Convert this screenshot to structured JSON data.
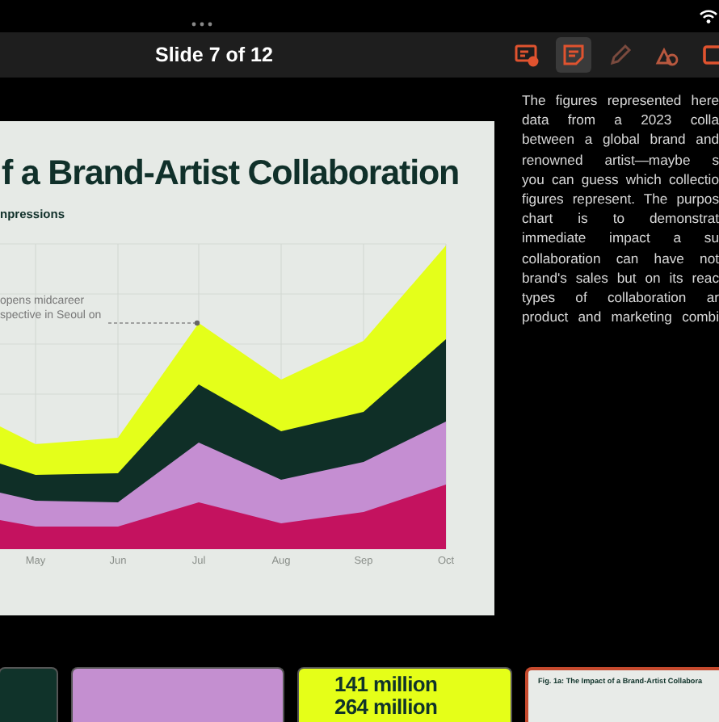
{
  "toolbar": {
    "title": "Slide 7 of 12",
    "tools": [
      {
        "kind": "presenter",
        "selected": false
      },
      {
        "kind": "notes",
        "selected": true
      },
      {
        "kind": "pen",
        "selected": false
      },
      {
        "kind": "shapes",
        "selected": false
      },
      {
        "kind": "display",
        "selected": false
      }
    ]
  },
  "slide": {
    "title": "f a Brand-Artist Collaboration",
    "subtitle": "npressions",
    "annotation": [
      "opens midcareer",
      "spective in Seoul on"
    ],
    "months": [
      "May",
      "Jun",
      "Jul",
      "Aug",
      "Sep",
      "Oct"
    ]
  },
  "notes": {
    "lines": [
      "The figures represented here",
      "data from a 2023 colla",
      "between a global brand and",
      "renowned artist—maybe s",
      "you can guess which collectio",
      "figures represent. The purpos",
      "chart is to demonstrat",
      "immediate impact a su",
      "collaboration can have not",
      "brand's sales but on its reac",
      "types of collaboration ar",
      "product and marketing combi"
    ]
  },
  "thumbnails": [
    {
      "kind": "dark",
      "selected": false
    },
    {
      "kind": "lilac",
      "selected": false
    },
    {
      "kind": "yellow",
      "selected": false,
      "texts": [
        "141 million",
        "264 million"
      ]
    },
    {
      "kind": "figure",
      "selected": true,
      "texts": [
        "Fig. 1a: The Impact of a Brand-Artist Collabora"
      ]
    }
  ]
}
